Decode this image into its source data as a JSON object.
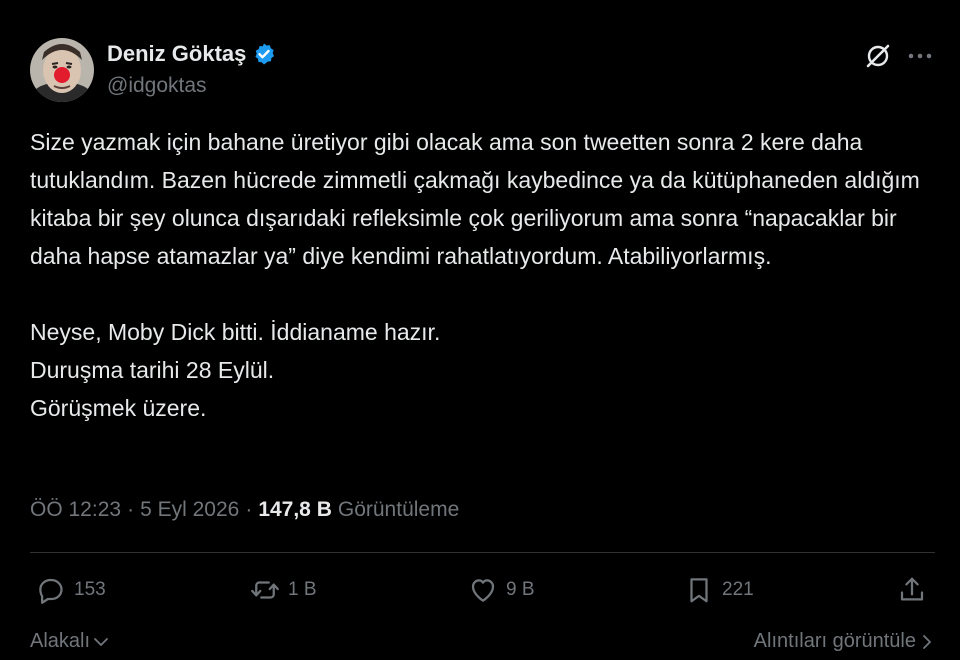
{
  "author": {
    "name": "Deniz Göktaş",
    "handle": "@idgoktas",
    "verified": true
  },
  "tweet": {
    "paragraphs": [
      [
        "Size yazmak için bahane üretiyor gibi olacak ama son tweetten sonra 2 kere daha tutuklandım. Bazen hücrede zimmetli çakmağı kaybedince ya da kütüphaneden aldığım kitaba bir şey olunca dışarıdaki refleksimle çok geriliyorum ama sonra “napacaklar bir daha hapse atamazlar ya” diye kendimi rahatlatıyordum. Atabiliyorlarmış."
      ],
      [
        "Neyse, Moby Dick bitti. İddianame hazır.",
        "Duruşma tarihi 28 Eylül.",
        "Görüşmek üzere."
      ]
    ]
  },
  "meta": {
    "time": "ÖÖ 12:23",
    "date": "5 Eyl 2026",
    "views": "147,8 B",
    "views_label": "Görüntüleme",
    "sep": "·"
  },
  "actions": {
    "replies": "153",
    "retweets": "1 B",
    "likes": "9 B",
    "bookmarks": "221"
  },
  "footer": {
    "sort_label": "Alakalı",
    "quotes_link": "Alıntıları görüntüle"
  },
  "colors": {
    "background": "#000000",
    "text": "#e7e9ea",
    "muted": "#71767b",
    "verified": "#1d9bf0"
  }
}
